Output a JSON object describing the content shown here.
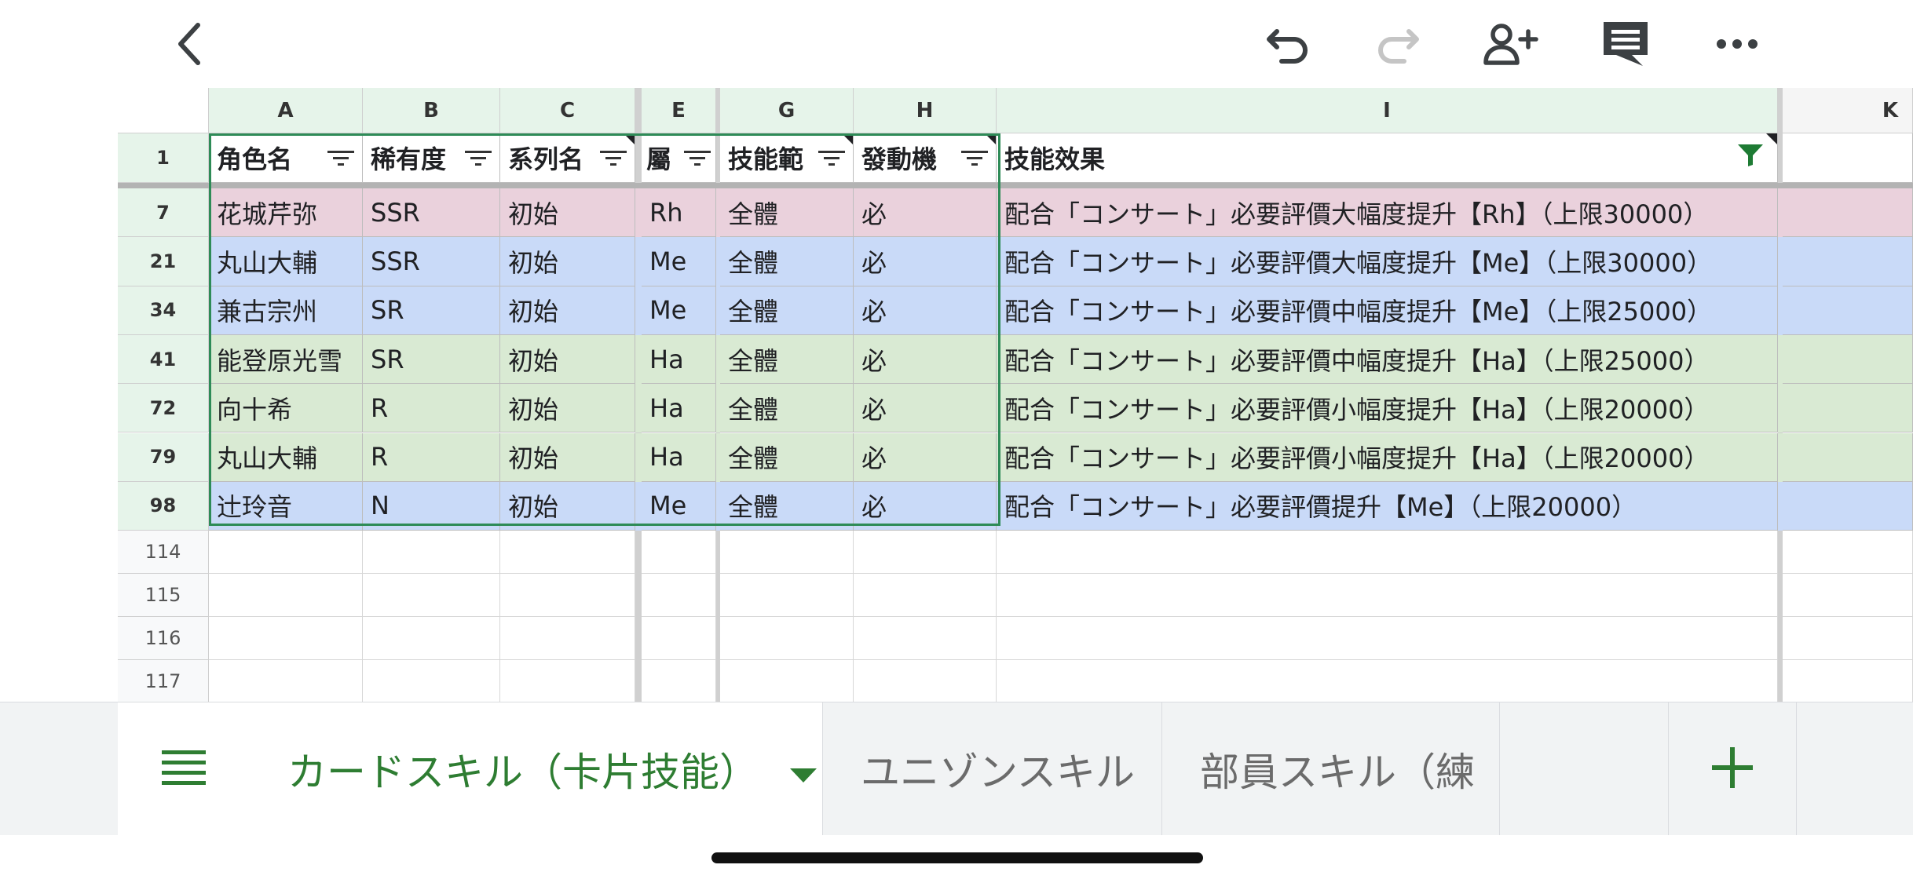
{
  "toolbar": {
    "back_icon": "chevron-left-icon",
    "undo_icon": "undo-icon",
    "redo_icon": "redo-icon",
    "share_icon": "add-person-icon",
    "comment_icon": "comment-icon",
    "more_icon": "more-horizontal-icon"
  },
  "columns": [
    "A",
    "B",
    "C",
    "E",
    "G",
    "H",
    "I",
    "K"
  ],
  "header_row": {
    "row_number": "1",
    "cells": [
      "角色名",
      "稀有度",
      "系列名",
      "屬",
      "技能範",
      "發動機",
      "技能效果"
    ]
  },
  "rows": [
    {
      "row_number": "7",
      "color": "#ead1dc",
      "cells": [
        "花城芹弥",
        "SSR",
        "初始",
        "Rh",
        "全體",
        "必",
        "配合「コンサート」必要評價大幅度提升【Rh】（上限30000）"
      ]
    },
    {
      "row_number": "21",
      "color": "#c9daf8",
      "cells": [
        "丸山大輔",
        "SSR",
        "初始",
        "Me",
        "全體",
        "必",
        "配合「コンサート」必要評價大幅度提升【Me】（上限30000）"
      ]
    },
    {
      "row_number": "34",
      "color": "#c9daf8",
      "cells": [
        "兼古宗州",
        "SR",
        "初始",
        "Me",
        "全體",
        "必",
        "配合「コンサート」必要評價中幅度提升【Me】（上限25000）"
      ]
    },
    {
      "row_number": "41",
      "color": "#d9ead3",
      "cells": [
        "能登原光雪",
        "SR",
        "初始",
        "Ha",
        "全體",
        "必",
        "配合「コンサート」必要評價中幅度提升【Ha】（上限25000）"
      ]
    },
    {
      "row_number": "72",
      "color": "#d9ead3",
      "cells": [
        "向十希",
        "R",
        "初始",
        "Ha",
        "全體",
        "必",
        "配合「コンサート」必要評價小幅度提升【Ha】（上限20000）"
      ]
    },
    {
      "row_number": "79",
      "color": "#d9ead3",
      "cells": [
        "丸山大輔",
        "R",
        "初始",
        "Ha",
        "全體",
        "必",
        "配合「コンサート」必要評價小幅度提升【Ha】（上限20000）"
      ]
    },
    {
      "row_number": "98",
      "color": "#c9daf8",
      "cells": [
        "辻玲音",
        "N",
        "初始",
        "Me",
        "全體",
        "必",
        "配合「コンサート」必要評價提升【Me】（上限20000）"
      ]
    }
  ],
  "empty_rows": [
    "114",
    "115",
    "116",
    "117"
  ],
  "tabs": {
    "menu_icon": "hamburger-menu-icon",
    "active_label": "カードスキル（卡片技能）",
    "tab2_label": "ユニゾンスキル",
    "tab3_label": "部員スキル（練",
    "add_icon": "plus-icon"
  },
  "colors": {
    "accent_green": "#2e7d32",
    "header_green": "#e6f4ea",
    "pink_row": "#ead1dc",
    "blue_row": "#c9daf8",
    "green_row": "#d9ead3"
  }
}
